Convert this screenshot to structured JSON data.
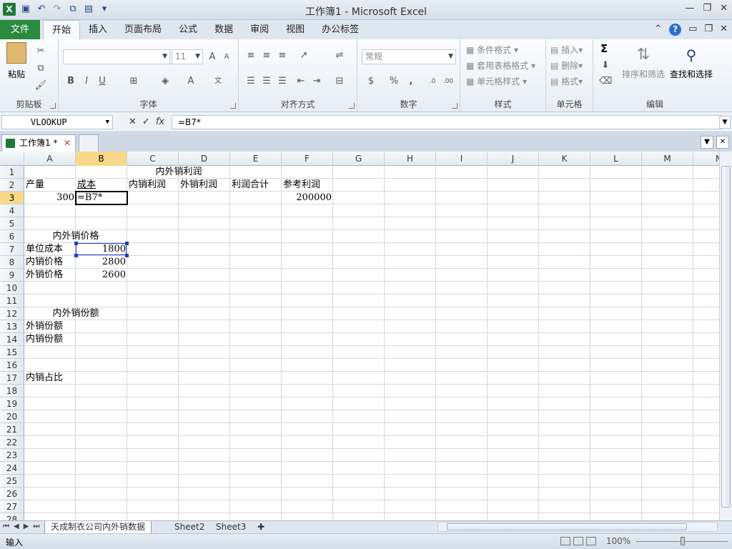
{
  "window": {
    "title": "工作簿1 - Microsoft Excel"
  },
  "ribbon_tabs": {
    "file": "文件",
    "items": [
      "开始",
      "插入",
      "页面布局",
      "公式",
      "数据",
      "审阅",
      "视图",
      "办公标签"
    ]
  },
  "ribbon": {
    "clipboard": {
      "label": "剪贴板",
      "paste": "粘贴"
    },
    "font": {
      "label": "字体",
      "font_size": "11",
      "bold": "B",
      "italic": "I",
      "underline": "U"
    },
    "alignment": {
      "label": "对齐方式"
    },
    "number": {
      "label": "数字",
      "format": "常规",
      "percent": "%",
      "comma": ","
    },
    "styles": {
      "label": "样式",
      "conditional": "条件格式",
      "table_format": "套用表格格式",
      "cell_style": "单元格样式"
    },
    "cells": {
      "label": "单元格",
      "insert": "插入",
      "delete": "删除",
      "format": "格式"
    },
    "editing": {
      "label": "编辑",
      "sum": "Σ",
      "sort_filter": "排序和筛选",
      "find_select": "查找和选择"
    }
  },
  "formula_bar": {
    "name_box": "VLOOKUP",
    "fx": "fx",
    "content": "=B7*"
  },
  "doc_tabs": {
    "active": "工作簿1 *"
  },
  "columns": [
    "A",
    "B",
    "C",
    "D",
    "E",
    "F",
    "G",
    "H",
    "I",
    "J",
    "K",
    "L",
    "M",
    "N"
  ],
  "rows": [
    "1",
    "2",
    "3",
    "4",
    "5",
    "6",
    "7",
    "8",
    "9",
    "10",
    "11",
    "12",
    "13",
    "14",
    "15",
    "16",
    "17",
    "18",
    "19",
    "20",
    "21",
    "22",
    "23",
    "24",
    "25",
    "26",
    "27",
    "28"
  ],
  "cells": {
    "C1": "内外销利润",
    "A2": "产量",
    "B2": "成本",
    "C2": "内销利润",
    "D2": "外销利润",
    "E2": "利润合计",
    "F2": "参考利润",
    "A3": "300",
    "B3": "=B7*",
    "F3": "200000",
    "A6": "内外销价格",
    "A7": "单位成本",
    "B7": "1800",
    "A8": "内销价格",
    "B8": "2800",
    "A9": "外销价格",
    "B9": "2600",
    "A12": "内外销份额",
    "A13": "外销份额",
    "A14": "内销份额",
    "A17": "内销占比"
  },
  "sheet_tabs": [
    "天成制衣公司内外销数据",
    "Sheet2",
    "Sheet3"
  ],
  "status": {
    "mode": "输入",
    "zoom": "100%"
  }
}
